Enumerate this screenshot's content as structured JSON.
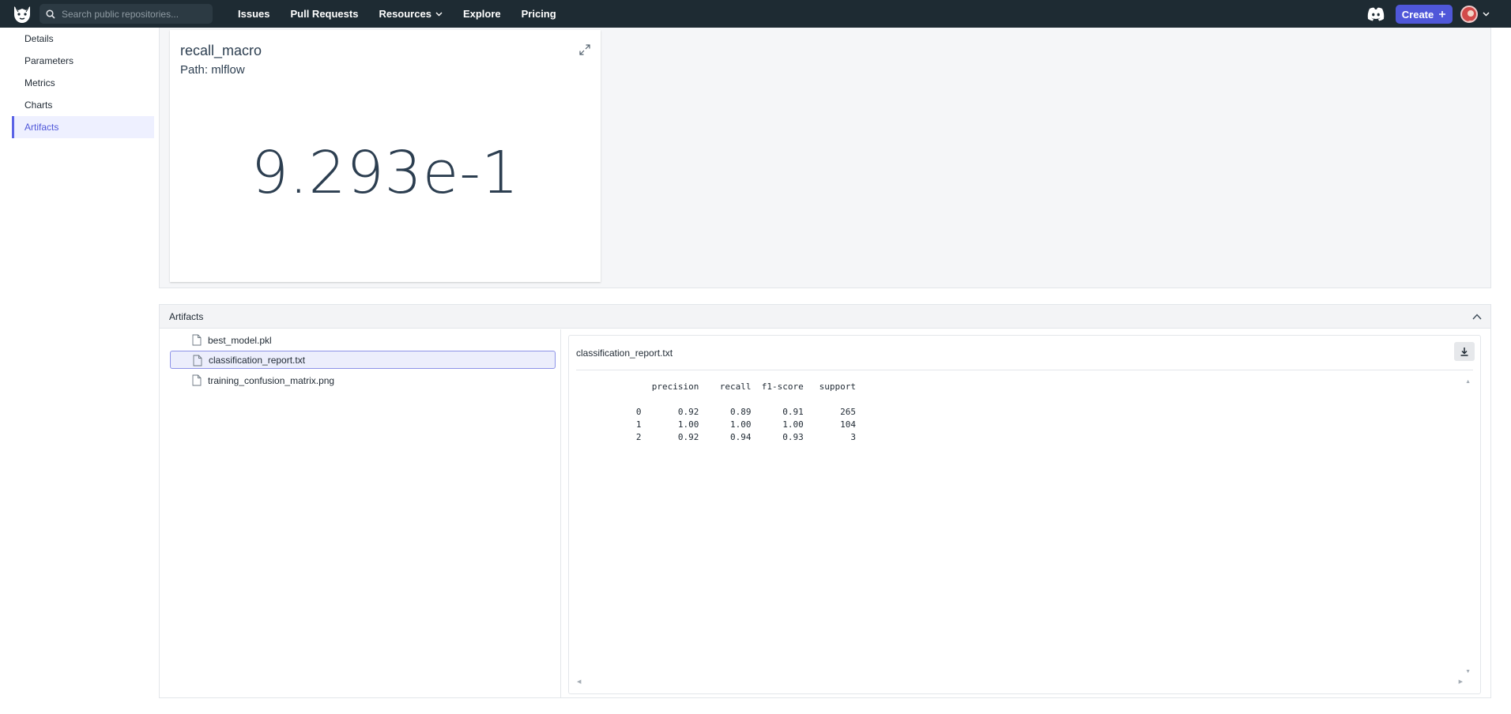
{
  "topbar": {
    "search_placeholder": "Search public repositories...",
    "nav": [
      {
        "label": "Issues"
      },
      {
        "label": "Pull Requests"
      },
      {
        "label": "Resources",
        "has_dropdown": true
      },
      {
        "label": "Explore"
      },
      {
        "label": "Pricing"
      }
    ],
    "create_label": "Create",
    "accent": "#4f57d9",
    "bar_color": "#1e2b33"
  },
  "sidebar": {
    "items": [
      {
        "label": "Details"
      },
      {
        "label": "Parameters"
      },
      {
        "label": "Metrics"
      },
      {
        "label": "Charts"
      },
      {
        "label": "Artifacts"
      }
    ],
    "active": "Artifacts"
  },
  "metric": {
    "title": "recall_macro",
    "path": "Path: mlflow",
    "value": "9.293e-1"
  },
  "artifacts": {
    "title": "Artifacts",
    "files": [
      {
        "name": "best_model.pkl"
      },
      {
        "name": "classification_report.txt"
      },
      {
        "name": "training_confusion_matrix.png"
      }
    ],
    "selected_file": "classification_report.txt",
    "viewer": {
      "title": "classification_report.txt",
      "report_text": "              precision    recall  f1-score   support\n\n           0       0.92      0.89      0.91       265\n           1       1.00      1.00      1.00       104\n           2       0.92      0.94      0.93         3"
    }
  }
}
